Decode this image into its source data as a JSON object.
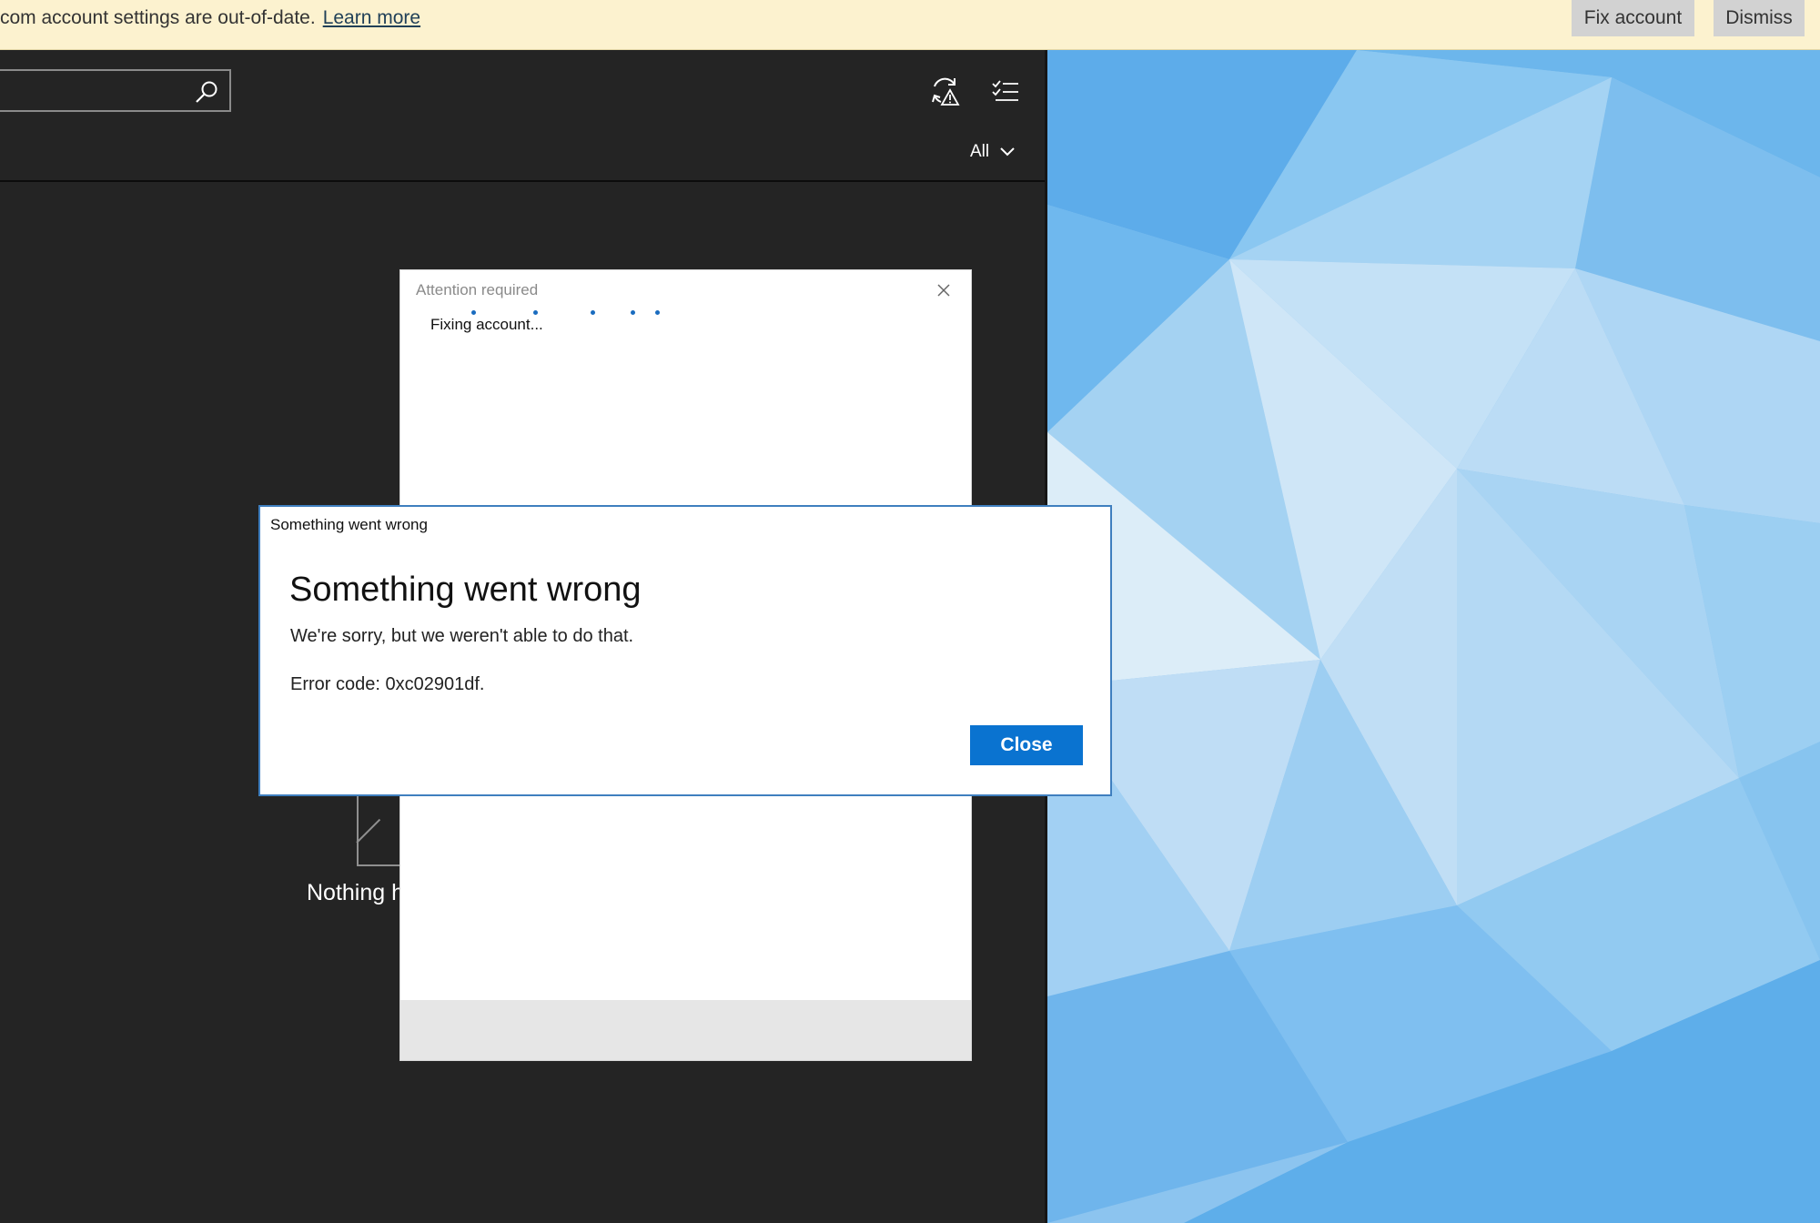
{
  "notification": {
    "text": "com account settings are out-of-date.",
    "link": "Learn more",
    "fix_button": "Fix account",
    "dismiss_button": "Dismiss"
  },
  "toolbar": {
    "search_icon": "search-icon",
    "sync_icon": "sync-warning-icon",
    "select_icon": "selection-mode-icon"
  },
  "filter": {
    "selected": "All",
    "icon": "chevron-down-icon"
  },
  "mail_list": {
    "empty_text": "Nothing h"
  },
  "attention_dialog": {
    "title": "Attention required",
    "status": "Fixing account...",
    "close_icon": "close-icon"
  },
  "error_dialog": {
    "titlebar": "Something went wrong",
    "heading": "Something went wrong",
    "message": "We're sorry, but we weren't able to do that.",
    "error_code": "Error code: 0xc02901df.",
    "close_button": "Close"
  },
  "colors": {
    "notification_bg": "#fcf2cf",
    "mail_bg": "#242424",
    "accent": "#0a73d0",
    "dialog_border": "#3f7fbf",
    "progress_dots": "#1a6cbf"
  }
}
